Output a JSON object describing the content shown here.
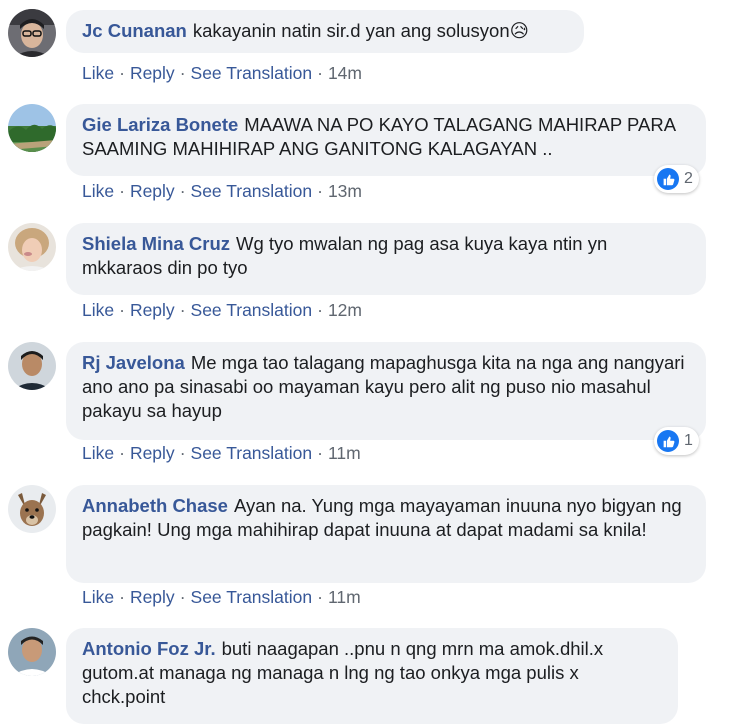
{
  "colors": {
    "author": "#385898",
    "bubble": "#f0f2f5",
    "like_badge": "#1877f2"
  },
  "actions": {
    "like": "Like",
    "reply": "Reply",
    "see_translation": "See Translation",
    "sep": "·"
  },
  "comments": [
    {
      "author": "Jc Cunanan",
      "text": "kakayanin natin sir.d yan ang solusyon😥",
      "time": "14m",
      "reactions": null
    },
    {
      "author": "Gie Lariza Bonete",
      "text": "MAAWA NA PO KAYO TALAGANG MAHIRAP PARA SAAMING MAHIHIRAP ANG GANITONG KALAGAYAN ..",
      "time": "13m",
      "reactions": "2"
    },
    {
      "author": "Shiela Mina Cruz",
      "text": "Wg tyo mwalan ng pag asa kuya kaya ntin yn mkkaraos din po tyo",
      "time": "12m",
      "reactions": null
    },
    {
      "author": "Rj Javelona",
      "text": "Me mga tao talagang mapaghusga kita na nga ang nangyari ano ano pa sinasabi oo mayaman kayu pero alit ng puso nio masahul pakayu sa hayup",
      "time": "11m",
      "reactions": "1"
    },
    {
      "author": "Annabeth Chase",
      "text": "Ayan na. Yung mga mayayaman inuuna nyo bigyan ng pagkain! Ung mga mahihirap dapat inuuna at dapat madami sa knila!",
      "time": "11m",
      "reactions": null
    },
    {
      "author": "Antonio Foz Jr.",
      "text": "buti naagapan ..pnu n qng mrn ma amok.dhil.x gutom.at managa ng managa n lng ng tao onkya mga pulis x chck.point",
      "time": "",
      "reactions": null
    }
  ]
}
